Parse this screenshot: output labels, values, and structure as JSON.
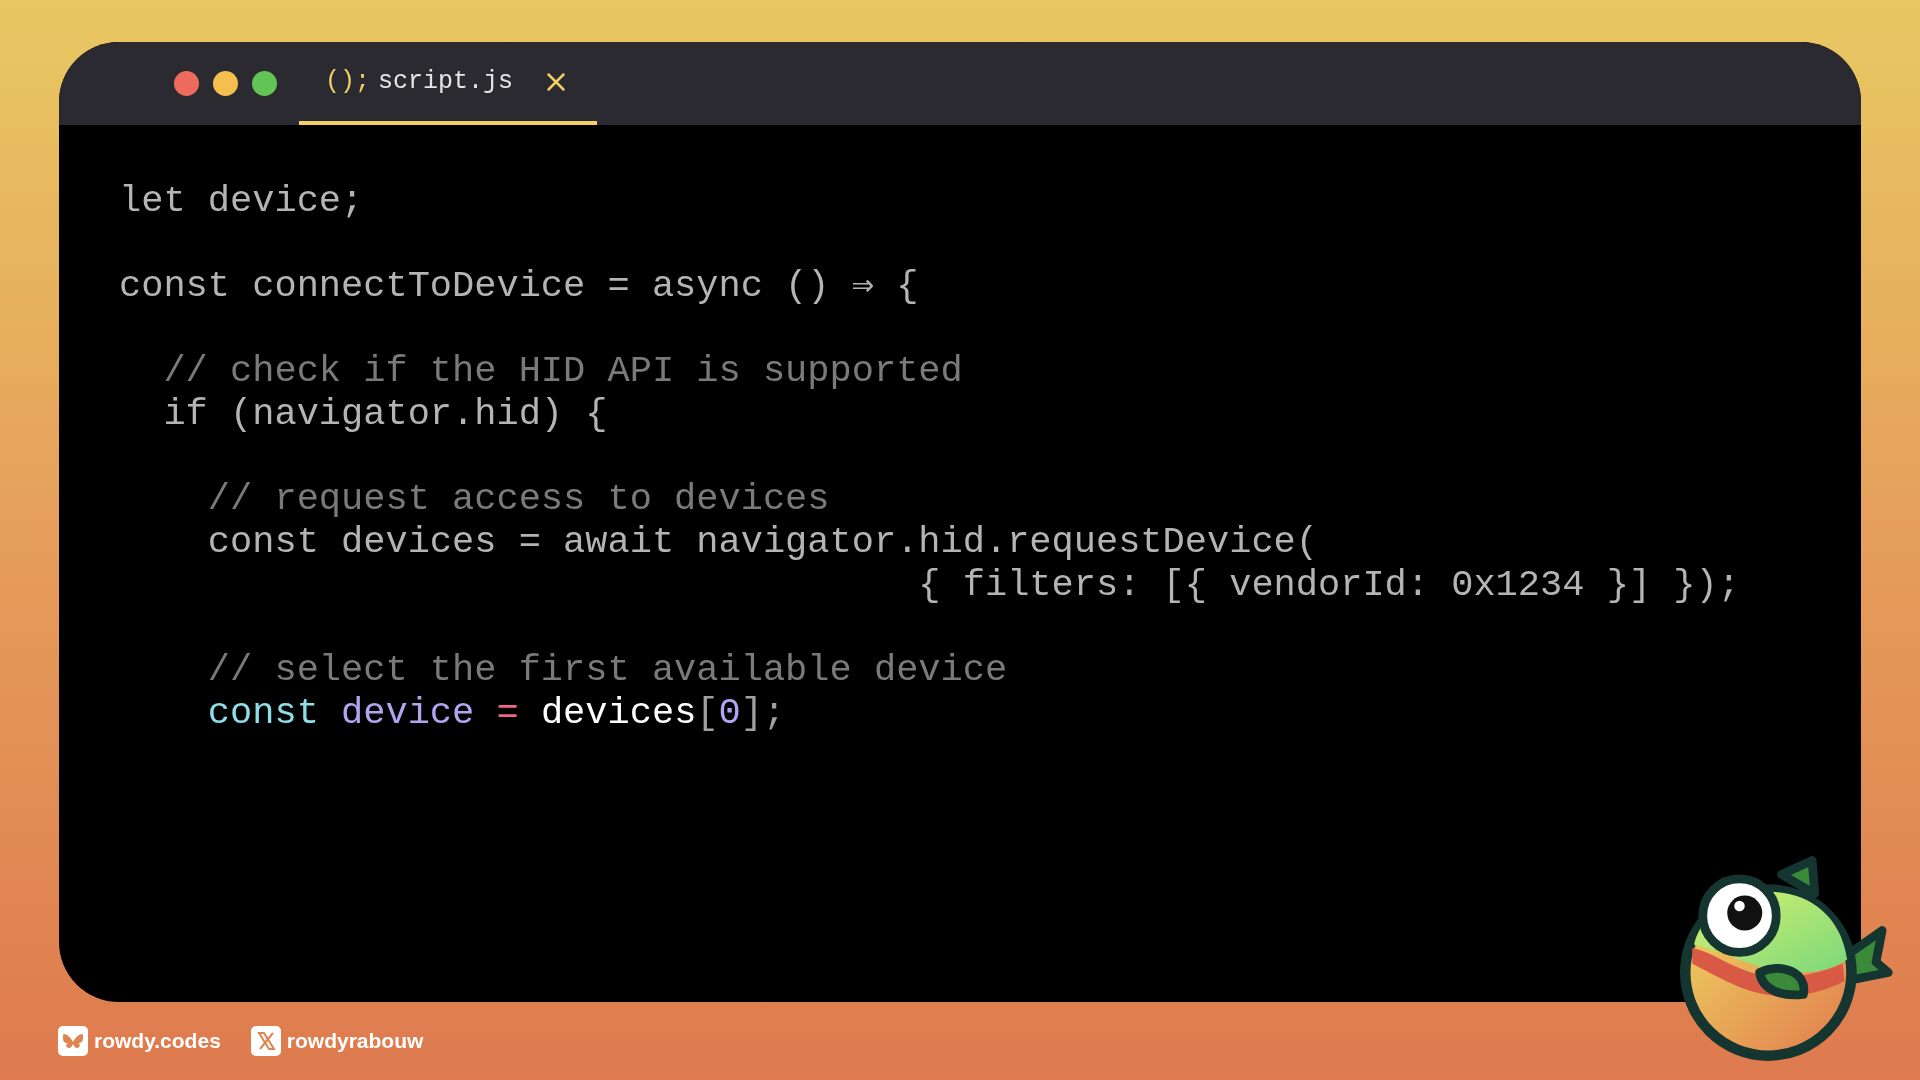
{
  "window": {
    "tab": {
      "icon_text": "();",
      "label": "script.js",
      "selected": true
    }
  },
  "code": {
    "blocks": [
      [
        [
          {
            "kind": "dim",
            "text": "let device;"
          }
        ]
      ],
      [
        [
          {
            "kind": "dim",
            "text": "const connectToDevice = async () ⇒ {"
          }
        ]
      ],
      [
        [
          {
            "kind": "comment",
            "text": "  // check if the HID API is supported"
          }
        ],
        [
          {
            "kind": "dim",
            "text": "  if (navigator.hid) {"
          }
        ]
      ],
      [
        [
          {
            "kind": "comment",
            "text": "    // request access to devices"
          }
        ],
        [
          {
            "kind": "dim",
            "text": "    const devices = await navigator.hid.requestDevice("
          }
        ],
        [
          {
            "kind": "dim",
            "text": "                                    { filters: [{ vendorId: 0x1234 }] });"
          }
        ]
      ],
      [
        [
          {
            "kind": "comment",
            "text": "    // select the first available device"
          }
        ],
        [
          {
            "kind": "keyword",
            "text": "    const"
          },
          {
            "kind": "variable",
            "text": " device"
          },
          {
            "kind": "operator",
            "text": " ="
          },
          {
            "kind": "plain",
            "text": " devices"
          },
          {
            "kind": "punct",
            "text": "["
          },
          {
            "kind": "number",
            "text": "0"
          },
          {
            "kind": "punct",
            "text": "];"
          }
        ]
      ]
    ]
  },
  "footer": {
    "links": [
      {
        "kind": "bluesky",
        "label": "rowdy.codes"
      },
      {
        "kind": "x",
        "label": "rowdyrabouw"
      }
    ]
  }
}
